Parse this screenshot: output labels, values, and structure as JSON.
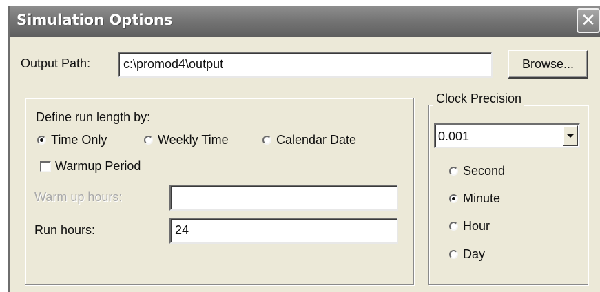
{
  "window": {
    "title": "Simulation Options",
    "close_glyph": "✕"
  },
  "output": {
    "label": "Output Path:",
    "value": "c:\\promod4\\output",
    "browse_label": "Browse..."
  },
  "run_length": {
    "heading": "Define run length by:",
    "options": [
      {
        "label": "Time Only",
        "checked": true
      },
      {
        "label": "Weekly Time",
        "checked": false
      },
      {
        "label": "Calendar Date",
        "checked": false
      }
    ],
    "warmup_checkbox_label": "Warmup Period",
    "warmup_checked": false,
    "warmup_hours_label": "Warm up hours:",
    "warmup_hours_value": "",
    "run_hours_label": "Run hours:",
    "run_hours_value": "24"
  },
  "clock_precision": {
    "legend": "Clock Precision",
    "selected_value": "0.001",
    "units": [
      {
        "label": "Second",
        "checked": false
      },
      {
        "label": "Minute",
        "checked": true
      },
      {
        "label": "Hour",
        "checked": false
      },
      {
        "label": "Day",
        "checked": false
      }
    ]
  },
  "icons": {
    "close": "close-icon",
    "dropdown": "chevron-down-icon"
  }
}
